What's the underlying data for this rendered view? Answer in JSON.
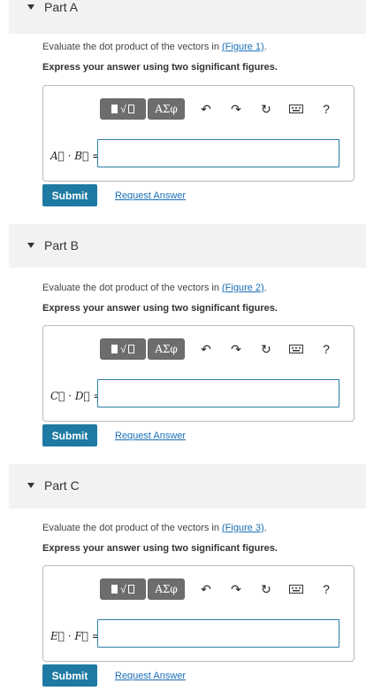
{
  "parts": [
    {
      "title": "Part A",
      "question_prefix": "Evaluate the dot product of the vectors in ",
      "figure_link": "(Figure 1)",
      "question_suffix": ".",
      "instruction": "Express your answer using two significant figures.",
      "var1": "A",
      "var2": "B",
      "answer_label": "A⃗ · B⃗ =",
      "answer_value": "",
      "submit_label": "Submit",
      "request_label": "Request Answer"
    },
    {
      "title": "Part B",
      "question_prefix": "Evaluate the dot product of the vectors in ",
      "figure_link": "(Figure 2)",
      "question_suffix": ".",
      "instruction": "Express your answer using two significant figures.",
      "answer_label": "C⃗ · D⃗ =",
      "answer_value": "",
      "submit_label": "Submit",
      "request_label": "Request Answer"
    },
    {
      "title": "Part C",
      "question_prefix": "Evaluate the dot product of the vectors in ",
      "figure_link": "(Figure 3)",
      "question_suffix": ".",
      "instruction": "Express your answer using two significant figures.",
      "answer_label": "E⃗ · F⃗ =",
      "answer_value": "",
      "submit_label": "Submit",
      "request_label": "Request Answer"
    }
  ],
  "toolbar": {
    "templates_icon": "templates-icon",
    "greek_label": "ΑΣφ",
    "undo_icon": "undo-icon",
    "redo_icon": "redo-icon",
    "reset_icon": "reset-icon",
    "keyboard_icon": "keyboard-icon",
    "help_label": "?"
  },
  "colors": {
    "submit": "#1e7aa3",
    "link": "#1a6fb5",
    "header_bg": "#f2f2f2"
  }
}
